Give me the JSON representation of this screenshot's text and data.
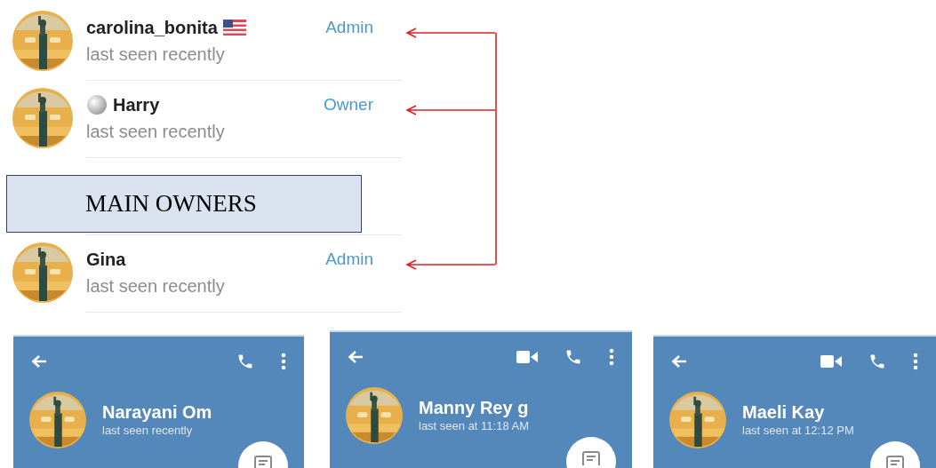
{
  "members_top": [
    {
      "name": "carolina_bonita",
      "orb_before": false,
      "flag_after": true,
      "subtitle": "last seen recently",
      "role": "Admin",
      "arrow": true
    },
    {
      "name": "Harry",
      "orb_before": true,
      "flag_after": false,
      "subtitle": "last seen recently",
      "role": "Owner",
      "arrow": true
    }
  ],
  "callout": {
    "text": "MAIN OWNERS"
  },
  "members_bottom": [
    {
      "name": "Gina",
      "orb_before": false,
      "flag_after": false,
      "subtitle": "last seen recently",
      "role": "Admin",
      "arrow": true
    }
  ],
  "chats": [
    {
      "name": "Narayani Om",
      "subtitle": "last seen recently",
      "video_call": false
    },
    {
      "name": "Manny Rey g",
      "subtitle": "last seen at 11:18 AM",
      "video_call": true
    },
    {
      "name": "Maeli Kay",
      "subtitle": "last seen at 12:12 PM",
      "video_call": true
    }
  ]
}
